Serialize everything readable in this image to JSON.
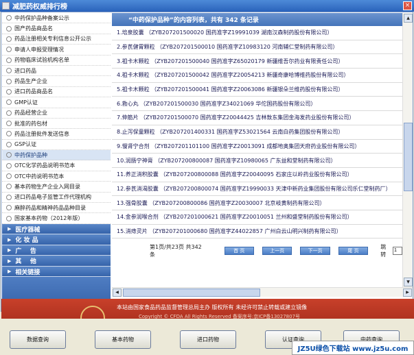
{
  "window": {
    "title": "减肥药权威排行榜",
    "close_label": "×"
  },
  "sidebar": {
    "items": [
      {
        "label": "中药保护品种备案公示"
      },
      {
        "label": "国产药品商品名"
      },
      {
        "label": "药品注册相关专利信息公开公示"
      },
      {
        "label": "申请人申报受理情况"
      },
      {
        "label": "药物临床试验机构名单"
      },
      {
        "label": "进口药品"
      },
      {
        "label": "药品生产企业"
      },
      {
        "label": "进口药品商品名"
      },
      {
        "label": "GMP认证"
      },
      {
        "label": "药品经营企业"
      },
      {
        "label": "批准的药包材"
      },
      {
        "label": "药品注册批件发送信息"
      },
      {
        "label": "GSP认证"
      },
      {
        "label": "中药保护品种"
      },
      {
        "label": "OTC化学药品说明书范本"
      },
      {
        "label": "OTC中药说明书范本"
      },
      {
        "label": "基本药物生产企业入网目录"
      },
      {
        "label": "进口药品电子监管工作代理机构"
      },
      {
        "label": "麻醉药品和精神药品品种目录"
      },
      {
        "label": "国家基本药物（2012年版）"
      }
    ],
    "categories": [
      {
        "label": "医疗器械"
      },
      {
        "label": "化 妆 品"
      },
      {
        "label": "广    告"
      },
      {
        "label": "其    他"
      },
      {
        "label": "相关链接"
      }
    ]
  },
  "list": {
    "header": "“中药保护品种”的内容列表，共有 342 条记录",
    "records": [
      {
        "text": "1.培泉胶囊 （ZYB207201500020 国药准字Z19991039 湖南汉森制药股份有限公司）"
      },
      {
        "text": "2.参芪健胃颗粒 （ZYB207201500010 国药准字Z10983120 河南辅仁堂制药有限公司）"
      },
      {
        "text": "3.祖卡木颗粒 （ZYB207201500040 国药准字Z65020179 新疆维吾尔药业有限责任公司）"
      },
      {
        "text": "4.祖卡木颗粒 （ZYB207201500042 国药准字Z20054213 新疆奇康哈博维药股份有限公司）"
      },
      {
        "text": "5.祖卡木颗粒 （ZYB207201500041 国药准字Z20063086 新疆银朵兰维药股份有限公司）"
      },
      {
        "text": "6.救心丸 （ZYB207201500030 国药准字Z34021069 华佗国药股份有限公司）"
      },
      {
        "text": "7.伸筋片 （ZYB207201500070 国药准字Z20044425 吉林敖东集团金海发药业股份有限公司）"
      },
      {
        "text": "8.止泻保童颗粒 （ZYB207201400331 国药准字Z53021564 云南白药集团股份有限公司）"
      },
      {
        "text": "9.慢肾宁合剂 （ZYB207201101100 国药准字Z20013091 成都地奥集团天府药业股份有限公司）"
      },
      {
        "text": "10.润肠宁神膏 （ZYB207200800087 国药准字Z10980065 广东益和堂制药有限公司）"
      },
      {
        "text": "11.养正消积胶囊 （ZYB207200800088 国药准字Z20040095 石家庄以岭药业股份有限公司）"
      },
      {
        "text": "12.参芪消渴胶囊 （ZYB207200800074 国药准字Z19990033 天津中新药业集团股份有限公司乐仁堂制药厂）"
      },
      {
        "text": "13.强骨胶囊 （ZYB207200800086 国药准字Z20030007 北京岐黄制药有限公司）"
      },
      {
        "text": "14.金参润喉合剂 （ZYB207201000621 国药准字Z20010051 兰州和盛堂制药股份有限公司）"
      },
      {
        "text": "15.消痔灵片 （ZYB207201000680 国药准字Z44022857 广州白云山明兴制药有限公司）"
      }
    ]
  },
  "pager": {
    "info": "第1页/共23页 共342条",
    "first": "首 页",
    "prev": "上一页",
    "next": "下一页",
    "last": "尾 页",
    "jump_label": "跳转",
    "jump_value": "1"
  },
  "footer": {
    "line1": "本站由国家食品药品监督管理总局主办 版权所有 未经许可禁止转载或建立镜像",
    "line2": "Copyright © CFDA All Rights Reserved    备案序号:京ICP备13027807号"
  },
  "bottom_buttons": [
    {
      "label": "数据查询"
    },
    {
      "label": "基本药物"
    },
    {
      "label": "进口药物"
    },
    {
      "label": "认证查询"
    },
    {
      "label": "中药查询"
    }
  ],
  "watermark": "JZ5U绿色下载站 www.jz5u.com",
  "colors": {
    "accent": "#3e6fb6",
    "footer_red": "#b8341f"
  }
}
